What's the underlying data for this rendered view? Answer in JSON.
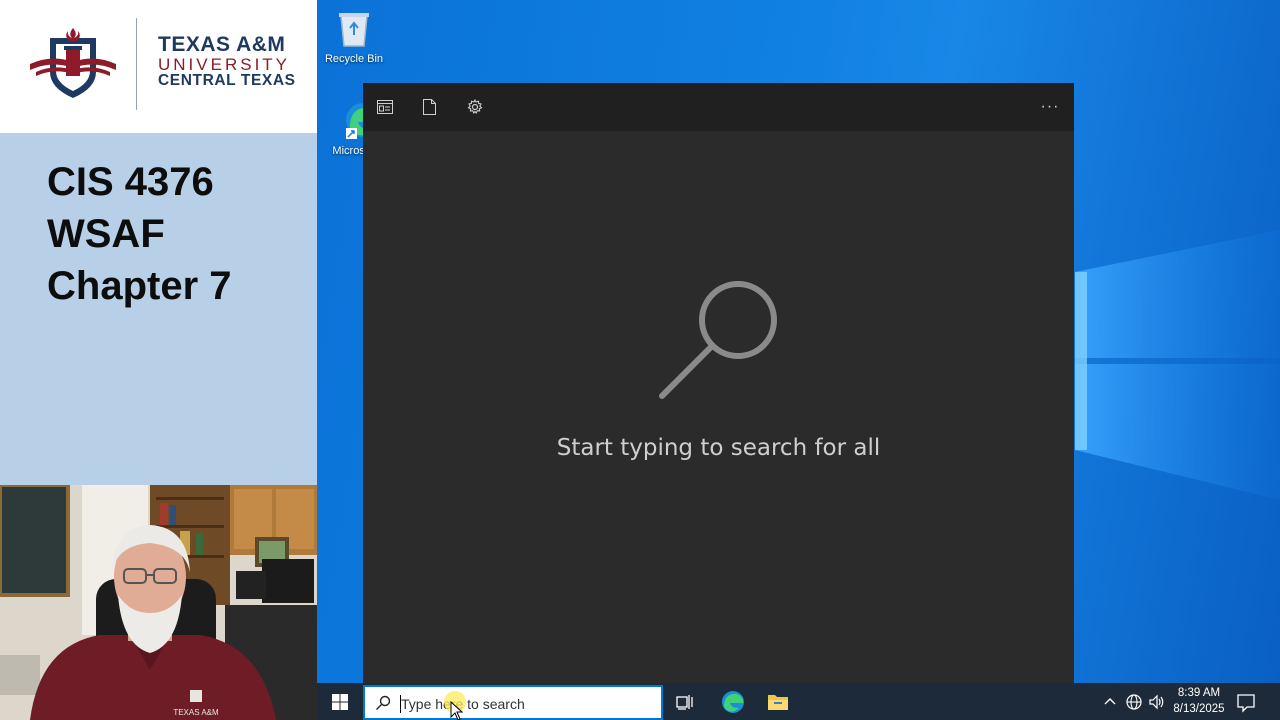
{
  "slide": {
    "logo": {
      "line1": "TEXAS A&M",
      "line2": "UNIVERSITY",
      "line3": "CENTRAL TEXAS"
    },
    "title_lines": [
      "CIS 4376",
      "WSAF",
      "Chapter 7"
    ],
    "webcam_shirt_text": "TEXAS A&M"
  },
  "desktop": {
    "icons": [
      {
        "label": "Recycle Bin",
        "icon": "recycle-bin-icon"
      },
      {
        "label": "Micros Edge",
        "icon": "edge-icon"
      }
    ]
  },
  "search_window": {
    "toolbar": [
      {
        "icon": "apps-icon",
        "label": "Apps"
      },
      {
        "icon": "documents-icon",
        "label": "Documents"
      },
      {
        "icon": "settings-gear-icon",
        "label": "Settings"
      }
    ],
    "more_label": "···",
    "empty_state_icon": "magnifier-icon",
    "empty_message": "Start typing to search for all"
  },
  "taskbar": {
    "start_icon": "windows-logo-icon",
    "search": {
      "placeholder": "Type here to search",
      "value": ""
    },
    "pinned_apps": [
      "task-view-icon",
      "edge-icon",
      "file-explorer-icon"
    ],
    "tray_icons": [
      "chevron-up-icon",
      "network-globe-icon",
      "speaker-icon"
    ],
    "clock": {
      "time": "8:39 AM",
      "date": "8/13/2025"
    },
    "notification_icon": "notification-icon"
  },
  "colors": {
    "taskbar": "#1d2a3a",
    "desktop_blue": "#0f7fe0",
    "search_window_bg": "#2b2b2b",
    "slide_title_bg": "#b8cfe8",
    "tamu_maroon": "#8d1b2a",
    "tamu_navy": "#1f3a60"
  }
}
